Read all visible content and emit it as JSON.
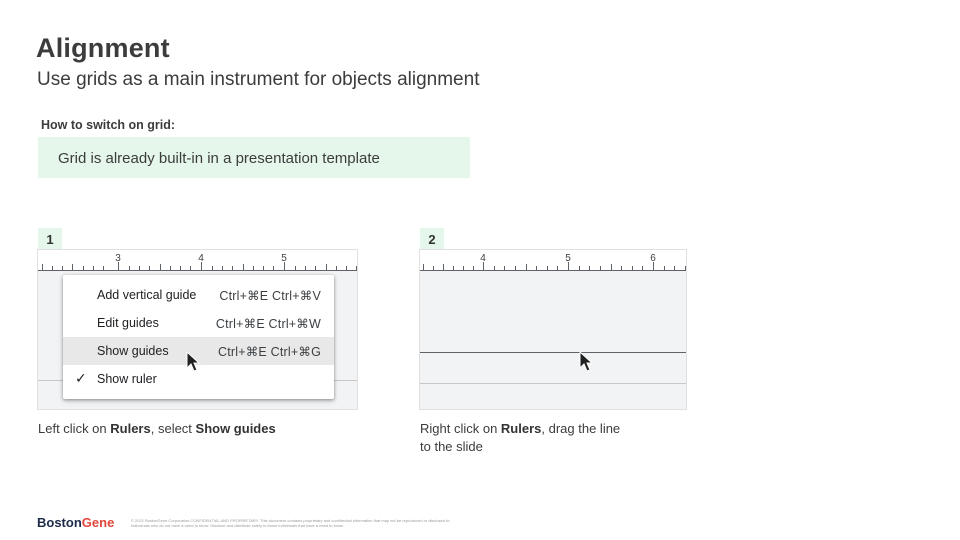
{
  "header": {
    "title": "Alignment",
    "subtitle": "Use grids as a main instrument for objects alignment"
  },
  "howto": {
    "label": "How to switch on grid:",
    "note": "Grid is already built-in in a presentation template"
  },
  "step1": {
    "number": "1",
    "ruler_numbers": [
      "3",
      "4",
      "5"
    ],
    "menu": [
      {
        "label": "Add vertical guide",
        "shortcut": "Ctrl+⌘E Ctrl+⌘V",
        "checked": false,
        "highlighted": false
      },
      {
        "label": "Edit guides",
        "shortcut": "Ctrl+⌘E Ctrl+⌘W",
        "checked": false,
        "highlighted": false
      },
      {
        "label": "Show guides",
        "shortcut": "Ctrl+⌘E Ctrl+⌘G",
        "checked": false,
        "highlighted": true
      },
      {
        "label": "Show ruler",
        "shortcut": "",
        "checked": true,
        "highlighted": false
      }
    ],
    "caption": {
      "p1": "Left click on ",
      "b1": "Rulers",
      "p2": ", select ",
      "b2": "Show guides"
    }
  },
  "step2": {
    "number": "2",
    "ruler_numbers": [
      "4",
      "5",
      "6"
    ],
    "caption": {
      "p1": "Right click on ",
      "b1": "Rulers",
      "p2": ", drag the line",
      "p3": "to the slide"
    }
  },
  "footer": {
    "logo_part1": "Boston",
    "logo_part2": "Gene",
    "legal": "© 2021 BostonGene Corporation CONFIDENTIAL AND PROPRIETARY. This document contains proprietary and confidential information that may not be reproduced or disclosed to individuals who do not have a need to know. Disclose and distribute solely to those individuals that have a need to know."
  },
  "colors": {
    "accent_green_bg": "#e4f7ea",
    "brand_navy": "#1c2b4a",
    "brand_red": "#e0463b"
  },
  "icons": {
    "pointer": "mouse-pointer-icon",
    "check": "checkmark-icon"
  }
}
